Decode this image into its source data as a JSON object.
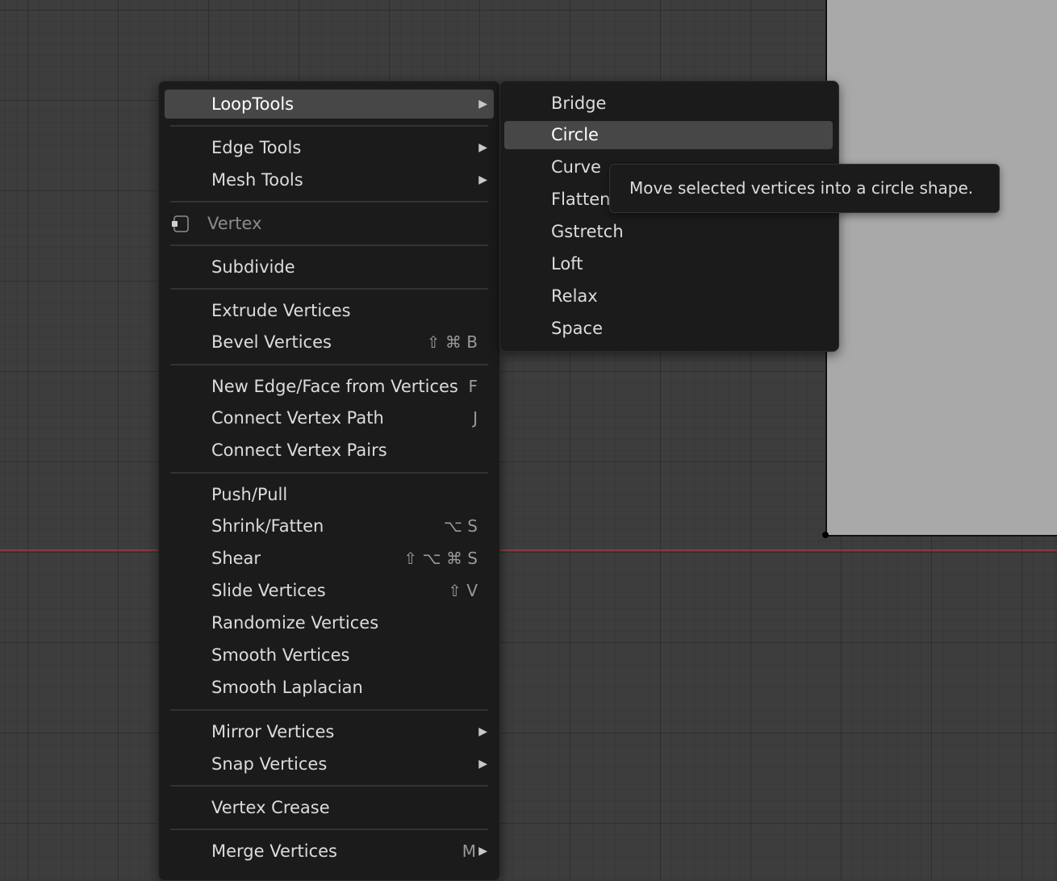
{
  "menu": {
    "items": [
      {
        "label": "LoopTools",
        "shortcut": "",
        "submenu": true,
        "active": true
      },
      {
        "label": "Edge Tools",
        "shortcut": "",
        "submenu": true
      },
      {
        "label": "Mesh Tools",
        "shortcut": "",
        "submenu": true
      },
      {
        "label": "Vertex",
        "shortcut": "",
        "disabled": true
      },
      {
        "label": "Subdivide",
        "shortcut": ""
      },
      {
        "label": "Extrude Vertices",
        "shortcut": ""
      },
      {
        "label": "Bevel Vertices",
        "shortcut": "⇧ ⌘ B"
      },
      {
        "label": "New Edge/Face from Vertices",
        "shortcut": "F"
      },
      {
        "label": "Connect Vertex Path",
        "shortcut": "J"
      },
      {
        "label": "Connect Vertex Pairs",
        "shortcut": ""
      },
      {
        "label": "Push/Pull",
        "shortcut": ""
      },
      {
        "label": "Shrink/Fatten",
        "shortcut": "⌥ S"
      },
      {
        "label": "Shear",
        "shortcut": "⇧ ⌥ ⌘ S"
      },
      {
        "label": "Slide Vertices",
        "shortcut": "⇧ V"
      },
      {
        "label": "Randomize Vertices",
        "shortcut": ""
      },
      {
        "label": "Smooth Vertices",
        "shortcut": ""
      },
      {
        "label": "Smooth Laplacian",
        "shortcut": ""
      },
      {
        "label": "Mirror Vertices",
        "shortcut": "",
        "submenu": true
      },
      {
        "label": "Snap Vertices",
        "shortcut": "",
        "submenu": true
      },
      {
        "label": "Vertex Crease",
        "shortcut": ""
      },
      {
        "label": "Merge Vertices",
        "shortcut": "M",
        "submenu": true
      }
    ],
    "submenu_arrow": "▶"
  },
  "looptools_submenu": {
    "items": [
      {
        "label": "Bridge"
      },
      {
        "label": "Circle",
        "active": true
      },
      {
        "label": "Curve"
      },
      {
        "label": "Flatten"
      },
      {
        "label": "Gstretch"
      },
      {
        "label": "Loft"
      },
      {
        "label": "Relax"
      },
      {
        "label": "Space"
      }
    ]
  },
  "tooltip": {
    "text": "Move selected vertices into a circle shape."
  },
  "icons": {
    "vertex_icon": "vertex-mode-icon",
    "submenu_arrow_icon": "triangle-right-icon"
  },
  "colors": {
    "menu_bg": "#1b1b1b",
    "highlight": "#474747",
    "viewport_bg": "#3d3d3d",
    "x_axis": "#8a3a3f",
    "plane": "#a9a9a9"
  }
}
